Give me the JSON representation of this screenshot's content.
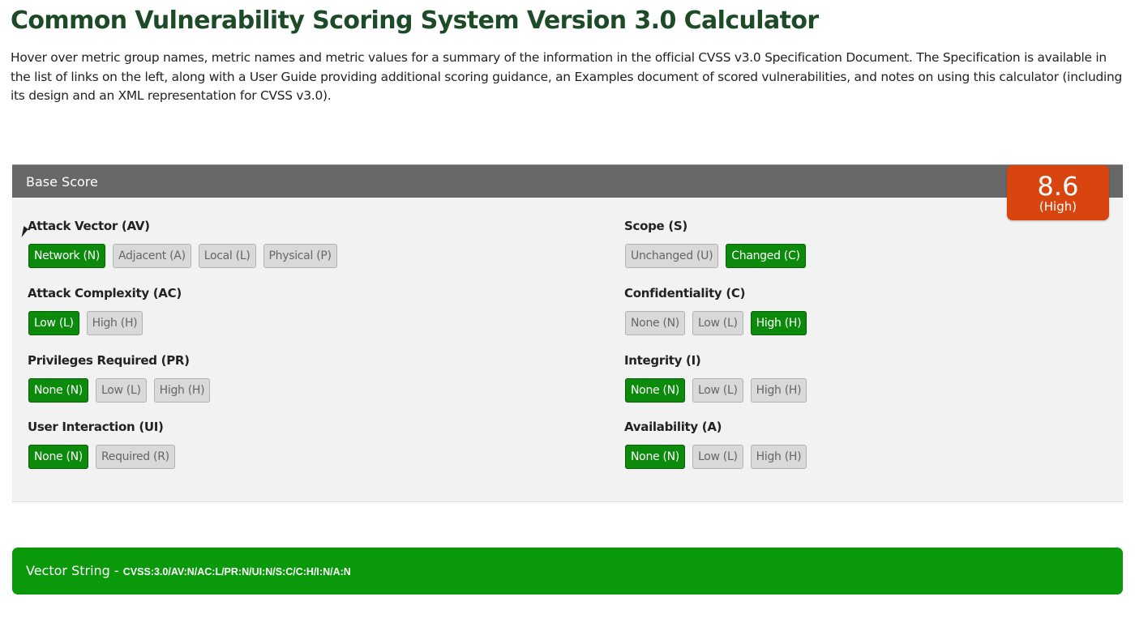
{
  "page": {
    "title": "Common Vulnerability Scoring System Version 3.0 Calculator",
    "intro": "Hover over metric group names, metric names and metric values for a summary of the information in the official CVSS v3.0 Specification Document. The Specification is available in the list of links on the left, along with a User Guide providing additional scoring guidance, an Examples document of scored vulnerabilities, and notes on using this calculator (including its design and an XML representation for CVSS v3.0)."
  },
  "base_score": {
    "header": "Base Score",
    "score": "8.6",
    "severity": "(High)",
    "left_metrics": [
      {
        "name": "Attack Vector (AV)",
        "values": [
          {
            "label": "Network (N)",
            "selected": true
          },
          {
            "label": "Adjacent (A)",
            "selected": false
          },
          {
            "label": "Local (L)",
            "selected": false
          },
          {
            "label": "Physical (P)",
            "selected": false
          }
        ]
      },
      {
        "name": "Attack Complexity (AC)",
        "values": [
          {
            "label": "Low (L)",
            "selected": true
          },
          {
            "label": "High (H)",
            "selected": false
          }
        ]
      },
      {
        "name": "Privileges Required (PR)",
        "values": [
          {
            "label": "None (N)",
            "selected": true
          },
          {
            "label": "Low (L)",
            "selected": false
          },
          {
            "label": "High (H)",
            "selected": false
          }
        ]
      },
      {
        "name": "User Interaction (UI)",
        "values": [
          {
            "label": "None (N)",
            "selected": true
          },
          {
            "label": "Required (R)",
            "selected": false
          }
        ]
      }
    ],
    "right_metrics": [
      {
        "name": "Scope (S)",
        "values": [
          {
            "label": "Unchanged (U)",
            "selected": false
          },
          {
            "label": "Changed (C)",
            "selected": true
          }
        ]
      },
      {
        "name": "Confidentiality (C)",
        "values": [
          {
            "label": "None (N)",
            "selected": false
          },
          {
            "label": "Low (L)",
            "selected": false
          },
          {
            "label": "High (H)",
            "selected": true
          }
        ]
      },
      {
        "name": "Integrity (I)",
        "values": [
          {
            "label": "None (N)",
            "selected": true
          },
          {
            "label": "Low (L)",
            "selected": false
          },
          {
            "label": "High (H)",
            "selected": false
          }
        ]
      },
      {
        "name": "Availability (A)",
        "values": [
          {
            "label": "None (N)",
            "selected": true
          },
          {
            "label": "Low (L)",
            "selected": false
          },
          {
            "label": "High (H)",
            "selected": false
          }
        ]
      }
    ]
  },
  "vector": {
    "label": "Vector String - ",
    "value": "CVSS:3.0/AV:N/AC:L/PR:N/UI:N/S:C/C:H/I:N/A:N"
  },
  "colors": {
    "title": "#1d4a27",
    "header_bg": "#686868",
    "panel_bg": "#f2f2f2",
    "selected_bg": "#0b8a0b",
    "unselected_bg": "#d9d9d9",
    "score_badge": "#d9450e",
    "vector_bar": "#0a990a"
  }
}
